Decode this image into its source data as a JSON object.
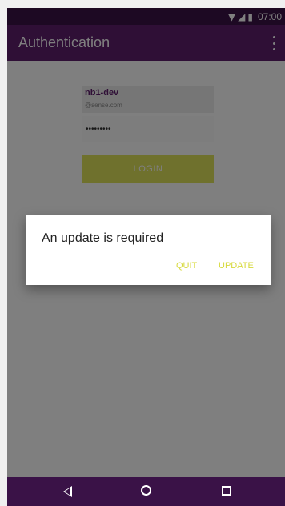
{
  "status_bar": {
    "time": "07:00",
    "icons": [
      "wifi-icon",
      "signal-icon",
      "battery-icon"
    ]
  },
  "app_bar": {
    "title": "Authentication",
    "menu_icon": "overflow-menu-icon"
  },
  "login_form": {
    "account_name": "nb1-dev",
    "account_domain": "@sense.com",
    "password_value": "•••••••••",
    "login_label": "LOGIN"
  },
  "dialog": {
    "title": "An update is required",
    "quit_label": "QUIT",
    "update_label": "UPDATE"
  },
  "nav_bar": {
    "back_icon": "back-triangle-icon",
    "home_icon": "home-circle-icon",
    "recents_icon": "recents-square-icon"
  },
  "colors": {
    "primary": "#5e1f6d",
    "primary_dark": "#3a1247",
    "accent": "#dfe25a"
  }
}
